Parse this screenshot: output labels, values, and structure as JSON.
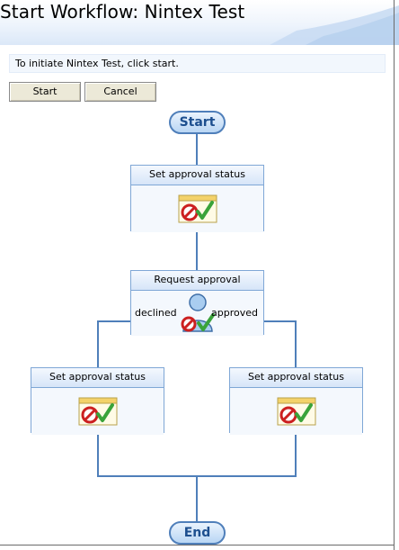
{
  "page": {
    "title": "Start Workflow: Nintex Test"
  },
  "instructions": "To initiate Nintex Test, click start.",
  "buttons": {
    "start": "Start",
    "cancel": "Cancel"
  },
  "workflow": {
    "start_label": "Start",
    "end_label": "End",
    "actions": {
      "set_approval_status_1": "Set approval status",
      "request_approval": "Request approval",
      "set_approval_status_declined": "Set approval status",
      "set_approval_status_approved": "Set approval status"
    },
    "branches": {
      "declined": "declined",
      "approved": "approved"
    }
  },
  "colors": {
    "connector": "#4f7fba",
    "node_border": "#7fa7d6",
    "pill_text": "#1d4f8f",
    "deny_red": "#cc2020",
    "approve_green": "#3aa33a"
  },
  "icons": [
    "approval-status-icon",
    "person-approval-icon",
    "deny-icon",
    "checkmark-icon"
  ]
}
